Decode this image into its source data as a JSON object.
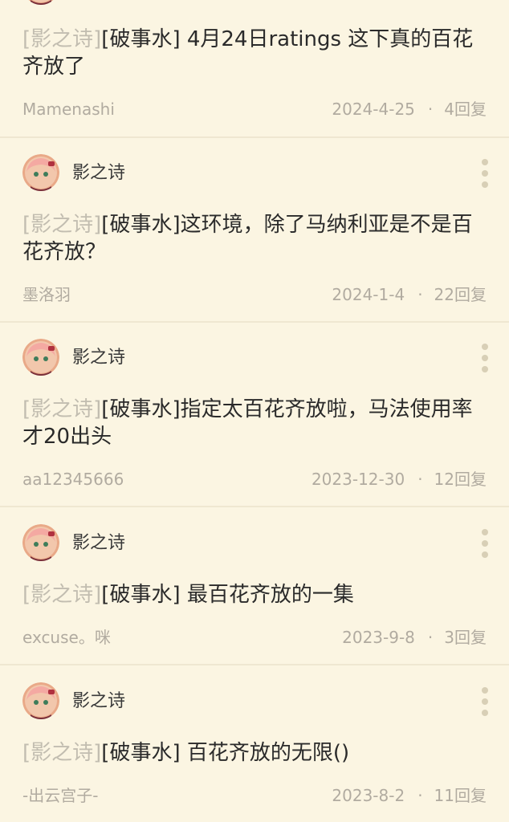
{
  "tag_label": "[影之诗]",
  "separator": "·",
  "posts": [
    {
      "title_rest": "[破事水] 4月24日ratings 这下真的百花齐放了",
      "user": "Mamenashi",
      "date": "2024-4-25",
      "replies": "4回复"
    },
    {
      "author": "影之诗",
      "title_rest": "[破事水]这环境，除了马纳利亚是不是百花齐放？",
      "user": "墨洛羽",
      "date": "2024-1-4",
      "replies": "22回复"
    },
    {
      "author": "影之诗",
      "title_rest": "[破事水]指定太百花齐放啦，马法使用率才20出头",
      "user": "aa12345666",
      "date": "2023-12-30",
      "replies": "12回复"
    },
    {
      "author": "影之诗",
      "title_rest": "[破事水] 最百花齐放的一集",
      "user": "excuse。咪",
      "date": "2023-9-8",
      "replies": "3回复"
    },
    {
      "author": "影之诗",
      "title_rest": "[破事水] 百花齐放的无限()",
      "user": "-出云宫子-",
      "date": "2023-8-2",
      "replies": "11回复"
    }
  ]
}
